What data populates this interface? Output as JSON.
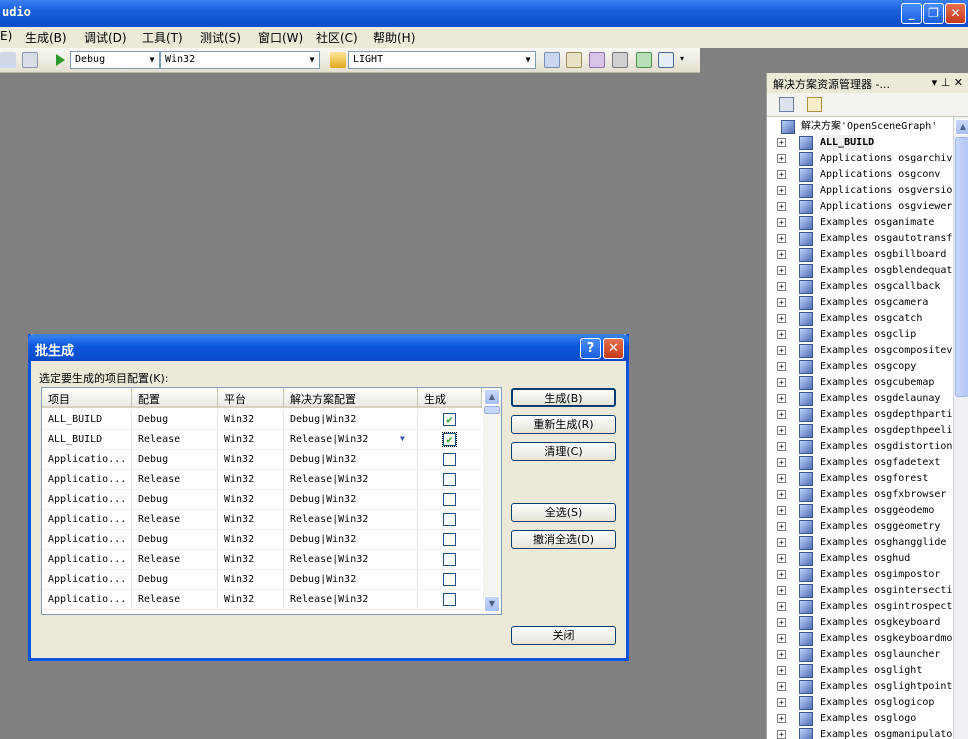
{
  "window": {
    "title": "udio",
    "buttons": {
      "minimize": "_",
      "maximize": "❐",
      "close": "✕"
    }
  },
  "menu": {
    "items": [
      {
        "label": "E)"
      },
      {
        "label": "生成(B)"
      },
      {
        "label": "调试(D)"
      },
      {
        "label": "工具(T)"
      },
      {
        "label": "测试(S)"
      },
      {
        "label": "窗口(W)"
      },
      {
        "label": "社区(C)"
      },
      {
        "label": "帮助(H)"
      }
    ]
  },
  "toolbar": {
    "config_value": "Debug",
    "platform_value": "Win32",
    "find_value": "LIGHT"
  },
  "solution_explorer": {
    "title": "解决方案资源管理器 -...",
    "pin": "▾ ⊥ ✕",
    "root": "解决方案'OpenSceneGraph'",
    "items": [
      "ALL_BUILD",
      "Applications osgarchiv",
      "Applications osgconv",
      "Applications osgversio",
      "Applications osgviewer",
      "Examples osganimate",
      "Examples osgautotransf",
      "Examples osgbillboard",
      "Examples osgblendequat",
      "Examples osgcallback",
      "Examples osgcamera",
      "Examples osgcatch",
      "Examples osgclip",
      "Examples osgcompositev",
      "Examples osgcopy",
      "Examples osgcubemap",
      "Examples osgdelaunay",
      "Examples osgdepthparti",
      "Examples osgdepthpeeli",
      "Examples osgdistortion",
      "Examples osgfadetext",
      "Examples osgforest",
      "Examples osgfxbrowser",
      "Examples osggeodemo",
      "Examples osggeometry",
      "Examples osghangglide",
      "Examples osghud",
      "Examples osgimpostor",
      "Examples osgintersecti",
      "Examples osgintrospect",
      "Examples osgkeyboard",
      "Examples osgkeyboardmo",
      "Examples osglauncher",
      "Examples osglight",
      "Examples osglightpoint",
      "Examples osglogicop",
      "Examples osglogo",
      "Examples osgmanipulato"
    ]
  },
  "dialog": {
    "title": "批生成",
    "help": "?",
    "close": "✕",
    "prompt": "选定要生成的项目配置(K):",
    "columns": [
      "项目",
      "配置",
      "平台",
      "解决方案配置",
      "生成"
    ],
    "rows": [
      {
        "project": "ALL_BUILD",
        "config": "Debug",
        "platform": "Win32",
        "solution": "Debug|Win32",
        "build": "✔"
      },
      {
        "project": "ALL_BUILD",
        "config": "Release",
        "platform": "Win32",
        "solution": "Release|Win32",
        "build": "✔"
      },
      {
        "project": "Applicatio...",
        "config": "Debug",
        "platform": "Win32",
        "solution": "Debug|Win32",
        "build": ""
      },
      {
        "project": "Applicatio...",
        "config": "Release",
        "platform": "Win32",
        "solution": "Release|Win32",
        "build": ""
      },
      {
        "project": "Applicatio...",
        "config": "Debug",
        "platform": "Win32",
        "solution": "Debug|Win32",
        "build": ""
      },
      {
        "project": "Applicatio...",
        "config": "Release",
        "platform": "Win32",
        "solution": "Release|Win32",
        "build": ""
      },
      {
        "project": "Applicatio...",
        "config": "Debug",
        "platform": "Win32",
        "solution": "Debug|Win32",
        "build": ""
      },
      {
        "project": "Applicatio...",
        "config": "Release",
        "platform": "Win32",
        "solution": "Release|Win32",
        "build": ""
      },
      {
        "project": "Applicatio...",
        "config": "Debug",
        "platform": "Win32",
        "solution": "Debug|Win32",
        "build": ""
      },
      {
        "project": "Applicatio...",
        "config": "Release",
        "platform": "Win32",
        "solution": "Release|Win32",
        "build": ""
      }
    ],
    "buttons": {
      "build": "生成(B)",
      "rebuild": "重新生成(R)",
      "clean": "清理(C)",
      "select_all": "全选(S)",
      "deselect_all": "撤消全选(D)",
      "close": "关闭"
    }
  },
  "colors": {
    "titlebar": "#0a54e3",
    "workspace": "#808080",
    "face": "#ece9d8"
  }
}
